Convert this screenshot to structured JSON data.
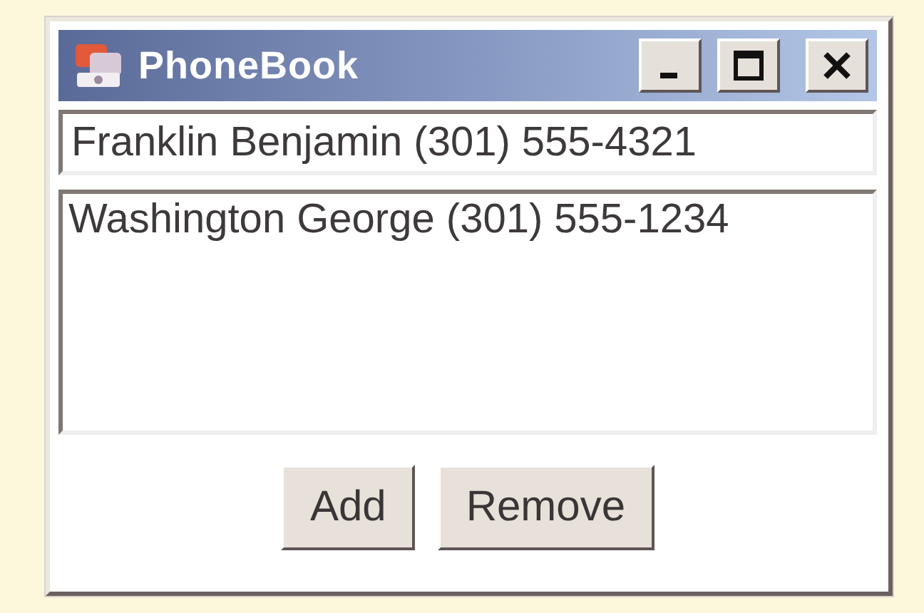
{
  "window": {
    "title": "PhoneBook"
  },
  "entry_field": {
    "value": "Franklin Benjamin (301) 555-4321"
  },
  "list": {
    "items": [
      {
        "text": "Washington George (301) 555-1234"
      }
    ]
  },
  "buttons": [
    "Add",
    "Remove"
  ]
}
